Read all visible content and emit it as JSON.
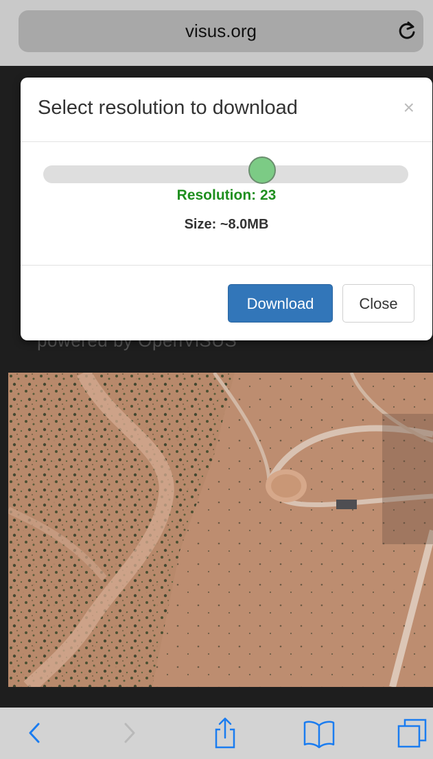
{
  "browser": {
    "url": "visus.org",
    "reload_icon": "reload-icon"
  },
  "page": {
    "powered_text": "powered by OpenViSUS",
    "map_description_icon": "satellite-map"
  },
  "modal": {
    "title": "Select resolution to download",
    "close_symbol": "×",
    "slider": {
      "value_fraction": 0.6
    },
    "resolution_text": "Resolution: 23",
    "size_text": "Size: ~8.0MB",
    "download_label": "Download",
    "close_label": "Close"
  },
  "toolbar": {
    "icons": [
      "back-icon",
      "forward-icon",
      "share-icon",
      "bookmarks-icon",
      "tabs-icon"
    ]
  },
  "colors": {
    "primary_button": "#3276b9",
    "resolution_text": "#1f8f1f",
    "slider_knob": "#7ccb85",
    "ios_blue": "#1a7cf0"
  }
}
